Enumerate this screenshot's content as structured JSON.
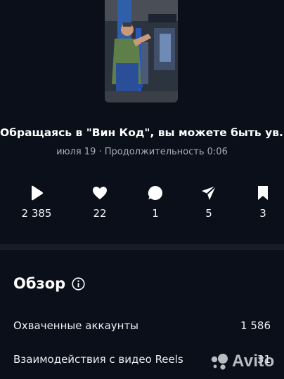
{
  "post": {
    "title": "Обращаясь в \"Вин Код\", вы можете быть ув...",
    "meta": "июля 19 · Продолжительность 0:06",
    "thumbnail_icon": "video-thumbnail-mechanic"
  },
  "stats": [
    {
      "icon": "play-icon",
      "value": "2 385"
    },
    {
      "icon": "heart-icon",
      "value": "22"
    },
    {
      "icon": "comment-icon",
      "value": "1"
    },
    {
      "icon": "share-icon",
      "value": "5"
    },
    {
      "icon": "bookmark-icon",
      "value": "3"
    }
  ],
  "overview": {
    "title": "Обзор",
    "rows": [
      {
        "label": "Охваченные аккаунты",
        "value": "1 586"
      },
      {
        "label": "Взаимодействия с видео Reels",
        "value": "31"
      }
    ]
  },
  "watermark": {
    "text": "Avito"
  },
  "colors": {
    "background": "#0b0f1a",
    "text": "#f2f3f5",
    "muted": "#a8acb5",
    "divider": "#181c26"
  }
}
